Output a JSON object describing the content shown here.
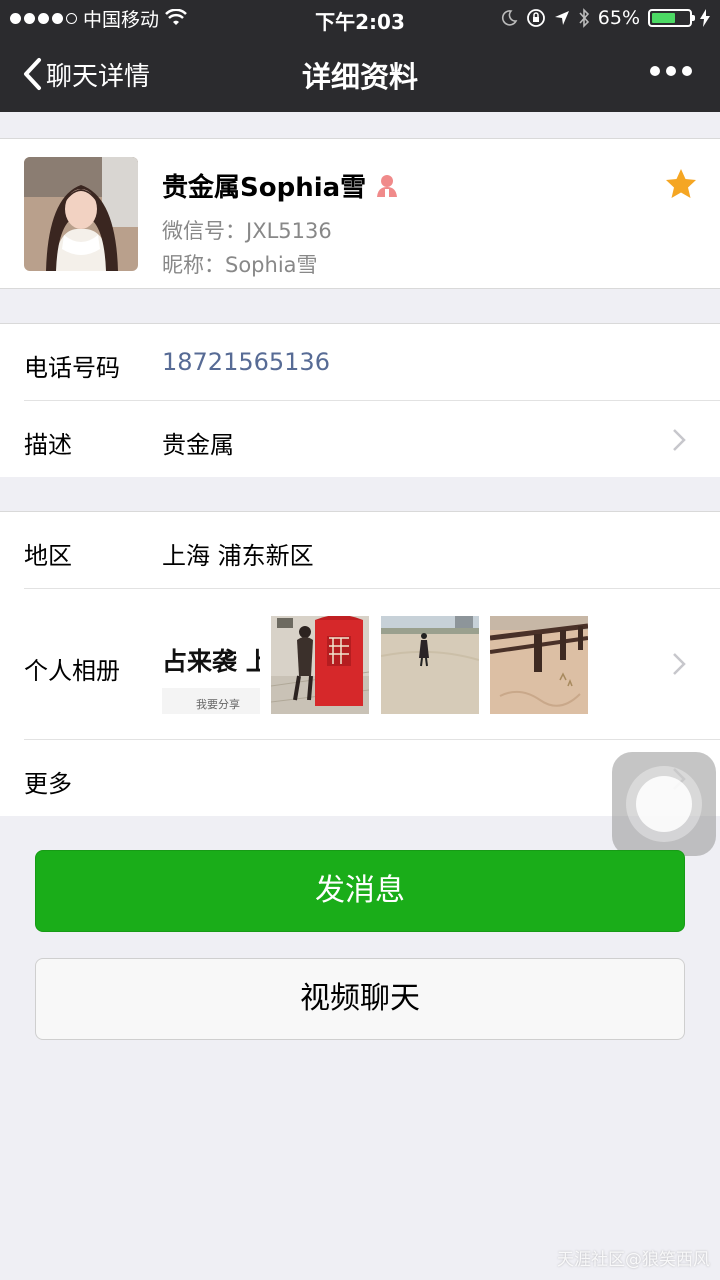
{
  "status_bar": {
    "carrier": "中国移动",
    "time": "下午2:03",
    "battery_text": "65%",
    "battery_level": 0.65
  },
  "nav": {
    "back_label": "聊天详情",
    "title": "详细资料"
  },
  "profile": {
    "name": "贵金属Sophia雪",
    "wechat_id": "微信号：JXL5136",
    "nickname": "昵称：Sophia雪",
    "starred": true,
    "gender_icon": "female-icon"
  },
  "info": {
    "phone_label": "电话号码",
    "phone_value": "18721565136",
    "desc_label": "描述",
    "desc_value": "贵金属",
    "region_label": "地区",
    "region_value": "上海 浦东新区",
    "album_label": "个人相册",
    "album_thumb_text": "占来袭 上",
    "album_thumb_subtext": "我要分享",
    "more_label": "更多"
  },
  "actions": {
    "send_message": "发消息",
    "video_chat": "视频聊天"
  },
  "watermark": "天涯社区@狼笑西风",
  "colors": {
    "nav_bg": "#2b2b2e",
    "page_bg": "#efeff4",
    "primary_green": "#1aad19",
    "phone_link": "#576b95",
    "star": "#f5a623"
  }
}
